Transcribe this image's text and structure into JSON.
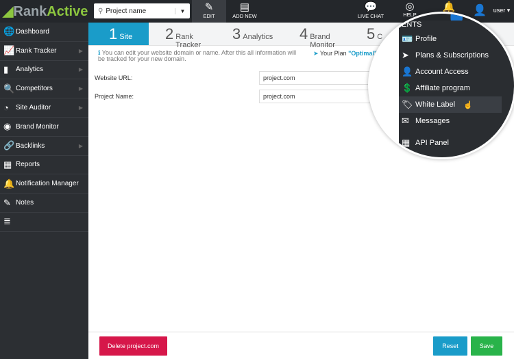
{
  "brand": {
    "name_a": "Rank",
    "name_b": "Active"
  },
  "search": {
    "value": "Project name"
  },
  "toolbar": {
    "edit": "EDIT",
    "add_new": "ADD NEW",
    "live_chat": "LIVE CHAT",
    "help": "HELP",
    "user": "user ▾"
  },
  "sidebar": {
    "items": [
      {
        "label": "Dashboard",
        "icon": "globe-icon",
        "arrow": false
      },
      {
        "label": "Rank Tracker",
        "icon": "chart-icon",
        "arrow": true
      },
      {
        "label": "Analytics",
        "icon": "bar-icon",
        "arrow": true
      },
      {
        "label": "Competitors",
        "icon": "magnifier-icon",
        "arrow": true
      },
      {
        "label": "Site Auditor",
        "icon": "gauge-icon",
        "arrow": true
      },
      {
        "label": "Brand Monitor",
        "icon": "fingerprint-icon",
        "arrow": false
      },
      {
        "label": "Backlinks",
        "icon": "link-icon",
        "arrow": true
      },
      {
        "label": "Reports",
        "icon": "report-icon",
        "arrow": false
      },
      {
        "label": "Notification Manager",
        "icon": "bell-icon",
        "arrow": false
      },
      {
        "label": "Notes",
        "icon": "note-icon",
        "arrow": false
      },
      {
        "label": "",
        "icon": "list-icon",
        "arrow": false
      }
    ]
  },
  "steps": [
    {
      "n": "1",
      "label": "Site"
    },
    {
      "n": "2",
      "label": "Rank Tracker"
    },
    {
      "n": "3",
      "label": "Analytics"
    },
    {
      "n": "4",
      "label": "Brand Monitor"
    },
    {
      "n": "5",
      "label": "C"
    }
  ],
  "info": "You can edit your website domain or name. After this all information will be tracked for your new domain.",
  "plan": {
    "prefix": "Your Plan ",
    "name": "\"Optimal\""
  },
  "form": {
    "url_label": "Website URL:",
    "url_value": "project.com",
    "name_label": "Project Name:",
    "name_value": "project.com"
  },
  "footer": {
    "delete": "Delete project.com",
    "reset": "Reset",
    "save": "Save"
  },
  "dropdown": {
    "header": "ENTS",
    "items": [
      "Profile",
      "Plans & Subscriptions",
      "Account Access",
      "Affiliate program",
      "White Label",
      "Messages",
      "API Panel"
    ],
    "hovered": "White Label",
    "peek": "tions"
  },
  "colors": {
    "accent": "#1a9cc9",
    "danger": "#d6174a",
    "success": "#29b34a",
    "brand_green": "#8cc63f"
  }
}
